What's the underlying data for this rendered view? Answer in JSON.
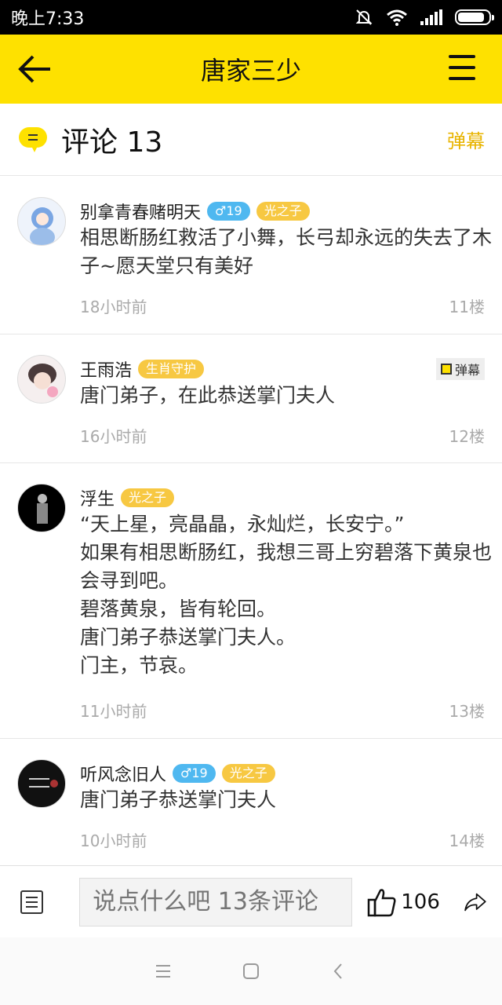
{
  "status_bar": {
    "time": "晚上7:33"
  },
  "app_bar": {
    "title": "唐家三少"
  },
  "header": {
    "heading": "评论 13",
    "danmu_label": "弹幕"
  },
  "comments": [
    {
      "username": "别拿青春赌明天",
      "gender_badge": "♂19",
      "title_badge": "光之子",
      "content": "相思断肠红救活了小舞，长弓却永远的失去了木子~愿天堂只有美好",
      "time": "18小时前",
      "floor": "11楼"
    },
    {
      "username": "王雨浩",
      "title_badge": "生肖守护",
      "danmu_chip": "弹幕",
      "content": "唐门弟子，在此恭送掌门夫人",
      "time": "16小时前",
      "floor": "12楼"
    },
    {
      "username": "浮生",
      "title_badge": "光之子",
      "content": "“天上星，亮晶晶，永灿烂，长安宁。”\n如果有相思断肠红，我想三哥上穷碧落下黄泉也会寻到吧。\n碧落黄泉，皆有轮回。\n唐门弟子恭送掌门夫人。\n门主，节哀。",
      "time": "11小时前",
      "floor": "13楼"
    },
    {
      "username": "听风念旧人",
      "gender_badge": "♂19",
      "title_badge": "光之子",
      "content": "唐门弟子恭送掌门夫人",
      "time": "10小时前",
      "floor": "14楼"
    }
  ],
  "bottom_bar": {
    "placeholder": "说点什么吧 13条评论",
    "like_count": "106"
  },
  "colors": {
    "accent": "#fee100",
    "title_badge": "#f7c842",
    "gender_badge": "#4fb8f0"
  }
}
